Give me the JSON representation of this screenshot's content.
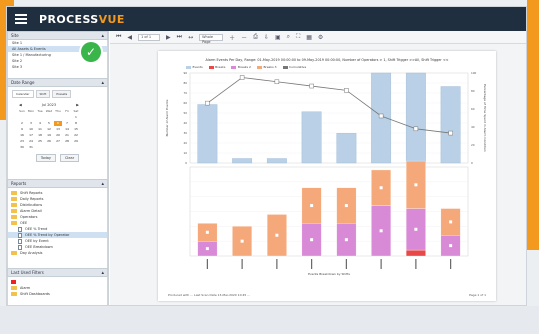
{
  "app": {
    "brand_main": "PROCESS",
    "brand_accent": "VUE",
    "accent_color": "#f39a1e",
    "titlebar_color": "#1f2f3f"
  },
  "sites_panel": {
    "title": "Site",
    "items": [
      "Site 1",
      "All Assets & Events",
      "Site 1 / Manufacturing",
      "Site 2",
      "Site 3"
    ]
  },
  "date_panel": {
    "title": "Date Range",
    "tabs": [
      "Calendar",
      "Shift",
      "Presets"
    ],
    "month": "Jul 2023",
    "weekdays": [
      "Sun",
      "Mon",
      "Tue",
      "Wed",
      "Thu",
      "Fri",
      "Sat"
    ],
    "days": [
      "",
      "",
      "",
      "",
      "",
      "",
      "1",
      "2",
      "3",
      "4",
      "5",
      "6",
      "7",
      "8",
      "9",
      "10",
      "11",
      "12",
      "13",
      "14",
      "15",
      "16",
      "17",
      "18",
      "19",
      "20",
      "21",
      "22",
      "23",
      "24",
      "25",
      "26",
      "27",
      "28",
      "29",
      "30",
      "31"
    ],
    "today": "6",
    "buttons": [
      "Today",
      "Clear"
    ]
  },
  "reports_panel": {
    "title": "Reports",
    "items": [
      {
        "label": "Shift Reports",
        "type": "folder",
        "sub": false
      },
      {
        "label": "Daily Reports",
        "type": "folder",
        "sub": false
      },
      {
        "label": "Distributions",
        "type": "folder",
        "sub": false
      },
      {
        "label": "Alarm Detail",
        "type": "folder",
        "sub": false
      },
      {
        "label": "Operators",
        "type": "folder",
        "sub": false
      },
      {
        "label": "OEE",
        "type": "folder",
        "sub": false
      },
      {
        "label": "OEE % Trend",
        "type": "doc",
        "sub": true
      },
      {
        "label": "OEE % Trend by Operator",
        "type": "doc",
        "sub": true,
        "selected": true
      },
      {
        "label": "OEE by Event",
        "type": "doc",
        "sub": true
      },
      {
        "label": "OEE Breakdown",
        "type": "doc",
        "sub": true
      },
      {
        "label": "Day Analysis",
        "type": "folder",
        "sub": false
      }
    ]
  },
  "last_used_panel": {
    "title": "Last Used Filters",
    "items": [
      {
        "label": "Alarm",
        "type": "folder"
      },
      {
        "label": "Shift Dashboards",
        "type": "folder"
      }
    ]
  },
  "toolbar": {
    "page_input": "1 of 1",
    "zoom_select": "Whole Page"
  },
  "report": {
    "title": "Alarm Events Per Day, Range: 01-May-2019 00:00:00 to 09-May-2019 00:00:00, Number of Operators > 1, Shift Trigger  >>All, Shift Trigger  <<",
    "legend": [
      {
        "name": "Events",
        "color": "#b9d0e6"
      },
      {
        "name": "Breaks",
        "color": "#e84848"
      },
      {
        "name": "Breaks 2",
        "color": "#d88ad6"
      },
      {
        "name": "Breaks 3",
        "color": "#f5a97a"
      },
      {
        "name": "Cumulative",
        "color": "#777777"
      }
    ],
    "footer_left": "Produced with ... Last Scan Date 13-Mar-2020 10:45 ...",
    "footer_right": "Page 1 of 1"
  },
  "chart_data": [
    {
      "type": "bar",
      "categories": [
        "",
        "",
        "",
        "",
        "",
        "",
        "",
        ""
      ],
      "values": [
        65,
        5,
        5,
        57,
        33,
        100,
        100,
        85
      ],
      "line": [
        70,
        100,
        95,
        90,
        85,
        55,
        40,
        35
      ],
      "ylim": [
        0,
        100
      ],
      "yticks": [
        "0",
        "10",
        "20",
        "30",
        "40",
        "50",
        "60",
        "70",
        "80",
        "90"
      ],
      "y2ticks": [
        "0",
        "20",
        "40",
        "60",
        "80",
        "100"
      ],
      "ylabel": "Number of Alarm Events",
      "y2label": "Percentage of Time Spent in Alarm Condition"
    },
    {
      "type": "bar",
      "categories": [
        "",
        "",
        "",
        "",
        "",
        "",
        "",
        ""
      ],
      "series": [
        {
          "name": "Breaks",
          "values": [
            0,
            0,
            0,
            0,
            0,
            0,
            2,
            0
          ],
          "color": "#e84848"
        },
        {
          "name": "Breaks 2",
          "values": [
            5,
            0,
            0,
            11,
            11,
            17,
            14,
            7
          ],
          "color": "#d88ad6"
        },
        {
          "name": "Breaks 3",
          "values": [
            6,
            10,
            14,
            12,
            12,
            12,
            16,
            9
          ],
          "color": "#f5a97a"
        }
      ],
      "ylim": [
        0,
        30
      ],
      "xlabel": "Events Breakdown by Shifts"
    }
  ]
}
